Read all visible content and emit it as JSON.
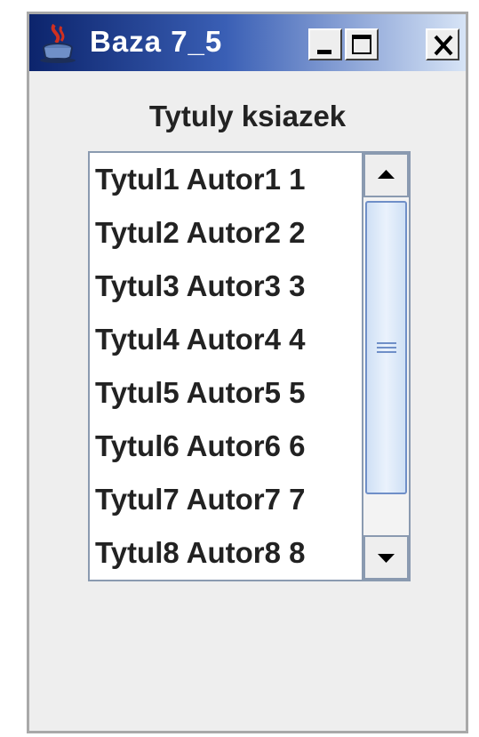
{
  "window": {
    "title": "Baza 7_5",
    "icon": "java-cup-icon",
    "controls": [
      "minimize-icon",
      "maximize-icon",
      "close-icon"
    ]
  },
  "content": {
    "heading": "Tytuly ksiazek",
    "list": {
      "items": [
        "Tytul1 Autor1 1",
        "Tytul2 Autor2 2",
        "Tytul3 Autor3 3",
        "Tytul4 Autor4 4",
        "Tytul5 Autor5 5",
        "Tytul6 Autor6 6",
        "Tytul7 Autor7 7",
        "Tytul8 Autor8 8"
      ]
    }
  },
  "colors": {
    "titlebar_start": "#0c246c",
    "titlebar_end": "#d7e4f6",
    "window_bg": "#eeeeee",
    "scroll_thumb": "#cfe0f5"
  }
}
